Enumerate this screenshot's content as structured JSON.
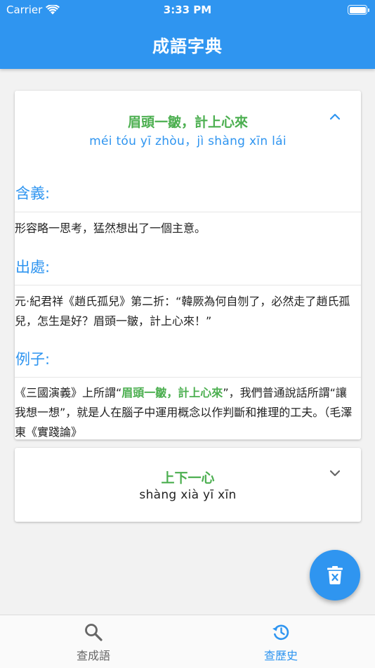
{
  "status_bar": {
    "carrier": "Carrier",
    "time": "3:33 PM"
  },
  "app_bar": {
    "title": "成語字典"
  },
  "entries": [
    {
      "idiom": "眉頭一皺，計上心來",
      "pinyin": "méi  tóu  yī  zhòu，jì  shàng  xīn  lái",
      "expanded": true,
      "meaning_label": "含義:",
      "meaning": "形容略一思考，猛然想出了一個主意。",
      "source_label": "出處:",
      "source": "元·紀君祥《趙氏孤兒》第二折：“韓厥為何自刎了，必然走了趙氏孤兒，怎生是好？眉頭一皺，計上心來！”",
      "example_label": "例子:",
      "example_before": "《三國演義》上所謂“",
      "example_highlight": "眉頭一皺，計上心來",
      "example_after": "”，我們普通說話所謂“讓我想一想”，就是人在腦子中運用概念以作判斷和推理的工夫。（毛澤東《實踐論》"
    },
    {
      "idiom": "上下一心",
      "pinyin": "shàng  xià  yī  xīn",
      "expanded": false
    }
  ],
  "fab": {
    "icon": "delete-sweep-icon"
  },
  "bottom_nav": [
    {
      "label": "查成語",
      "icon": "search-icon",
      "active": false
    },
    {
      "label": "查歷史",
      "icon": "history-icon",
      "active": true
    }
  ],
  "colors": {
    "primary": "#2f95f0",
    "idiom_green": "#4caf50"
  }
}
